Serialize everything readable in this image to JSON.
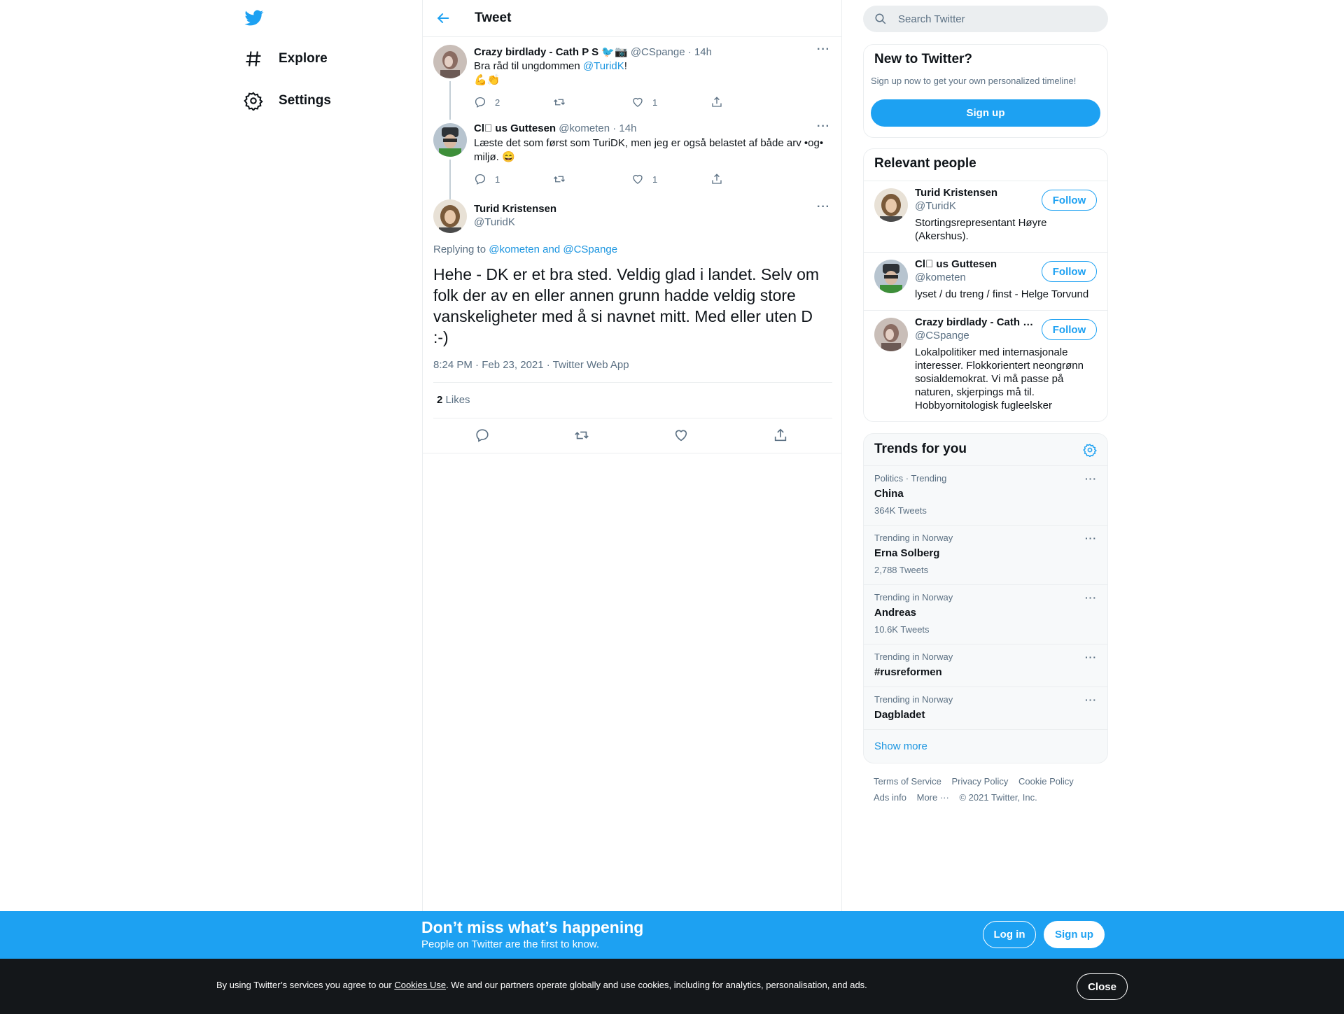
{
  "nav": {
    "items": [
      {
        "label": "Explore",
        "icon": "hashtag-icon"
      },
      {
        "label": "Settings",
        "icon": "gear-icon"
      }
    ]
  },
  "header": {
    "title": "Tweet"
  },
  "thread": [
    {
      "name": "Crazy birdlady - Cath P S",
      "name_emoji": "🐦‍📷",
      "handle": "@CSpange",
      "time": "· 14h",
      "text_before": "Bra råd til ungdommen ",
      "mention": "@TuridK",
      "text_after": "!",
      "text_line2": "💪👏",
      "replies": "2",
      "retweets": "",
      "likes": "1"
    },
    {
      "name": "Cl⃝ us Guttesen",
      "handle": "@kometen",
      "time": "· 14h",
      "text": "Læste det som først som TuriDK, men jeg er også belastet af både arv •og• miljø. 😄",
      "replies": "1",
      "retweets": "",
      "likes": "1"
    }
  ],
  "main_tweet": {
    "name": "Turid Kristensen",
    "handle": "@TuridK",
    "replying_prefix": "Replying to ",
    "replying_to": "@kometen and @CSpange",
    "text": "Hehe - DK er et bra sted. Veldig glad i landet. Selv om folk der av en eller annen grunn hadde veldig store vanskeligheter med å si navnet mitt. Med eller uten D :-)",
    "timestamp": "8:24 PM · Feb 23, 2021 · Twitter Web App",
    "likes_count": "2",
    "likes_label": "Likes"
  },
  "search": {
    "placeholder": "Search Twitter"
  },
  "new_to_twitter": {
    "title": "New to Twitter?",
    "subtitle": "Sign up now to get your own personalized timeline!",
    "button": "Sign up"
  },
  "relevant_people": {
    "title": "Relevant people",
    "follow_label": "Follow",
    "people": [
      {
        "name": "Turid Kristensen",
        "handle": "@TuridK",
        "bio": "Stortingsrepresentant Høyre (Akershus)."
      },
      {
        "name": "Cl⃝ us Guttesen",
        "handle": "@kometen",
        "bio": "lyset / du treng / finst - Helge Torvund"
      },
      {
        "name": "Crazy birdlady - Cath P S",
        "handle": "@CSpange",
        "bio": "Lokalpolitiker med internasjonale interesser. Flokkorientert neongrønn sosialdemokrat. Vi må passe på naturen, skjerpings må til. Hobbyornitologisk fugleelsker"
      }
    ]
  },
  "trends": {
    "title": "Trends for you",
    "items": [
      {
        "context": "Politics · Trending",
        "name": "China",
        "count": "364K Tweets"
      },
      {
        "context": "Trending in Norway",
        "name": "Erna Solberg",
        "count": "2,788 Tweets"
      },
      {
        "context": "Trending in Norway",
        "name": "Andreas",
        "count": "10.6K Tweets"
      },
      {
        "context": "Trending in Norway",
        "name": "#rusreformen",
        "count": ""
      },
      {
        "context": "Trending in Norway",
        "name": "Dagbladet",
        "count": ""
      }
    ],
    "show_more": "Show more"
  },
  "footer": {
    "terms": "Terms of Service",
    "privacy": "Privacy Policy",
    "cookie": "Cookie Policy",
    "ads": "Ads info",
    "more": "More ···",
    "copyright": "© 2021 Twitter, Inc."
  },
  "promo": {
    "title": "Don’t miss what’s happening",
    "subtitle": "People on Twitter are the first to know.",
    "login": "Log in",
    "signup": "Sign up"
  },
  "cookie_bar": {
    "text_before": "By using Twitter’s services you agree to our ",
    "link": "Cookies Use",
    "text_after": ". We and our partners operate globally and use cookies, including for analytics, personalisation, and ads.",
    "close": "Close"
  },
  "colors": {
    "accent": "#1da1f2",
    "link": "#1b95e0",
    "muted": "#5b7083",
    "cookie_bg": "#14171a"
  }
}
